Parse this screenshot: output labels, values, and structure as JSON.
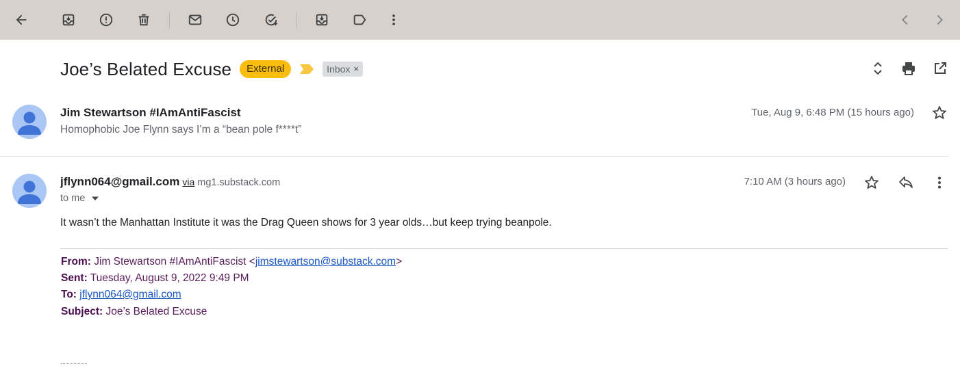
{
  "toolbar": {
    "icons": [
      "back-arrow-icon",
      "archive-icon",
      "report-spam-icon",
      "delete-icon",
      "mark-unread-icon",
      "snooze-icon",
      "add-to-tasks-icon",
      "move-to-icon",
      "label-icon",
      "more-vert-icon",
      "prev-chevron-icon",
      "next-chevron-icon"
    ],
    "background": "#d8d0cb"
  },
  "thread": {
    "subject": "Joe’s Belated Excuse",
    "external_badge": "External",
    "label_chip": "Inbox",
    "label_chip_remove": "×",
    "badge_color": "#f9bd10"
  },
  "messages": [
    {
      "sender": "Jim Stewartson #IAmAntiFascist",
      "snippet": "Homophobic Joe Flynn says I’m a “bean pole f****t”",
      "date": "Tue, Aug 9, 6:48 PM (15 hours ago)"
    },
    {
      "sender": "jflynn064@gmail.com",
      "via": "via",
      "via_domain": "mg1.substack.com",
      "recipient": "to me",
      "date": "7:10 AM (3 hours ago)",
      "body": "It wasn’t the Manhattan Institute it was the Drag Queen shows for 3 year olds…but keep trying beanpole.",
      "quoted": {
        "from_label": "From:",
        "from_name": "Jim Stewartson #IAmAntiFascist",
        "from_lt": "<",
        "from_email": "jimstewartson@substack.com",
        "from_gt": ">",
        "sent_label": "Sent:",
        "sent_value": "Tuesday, August 9, 2022 9:49 PM",
        "to_label": "To:",
        "to_email": "jflynn064@gmail.com",
        "subject_label": "Subject:",
        "subject_value": "Joe’s Belated Excuse"
      }
    }
  ]
}
